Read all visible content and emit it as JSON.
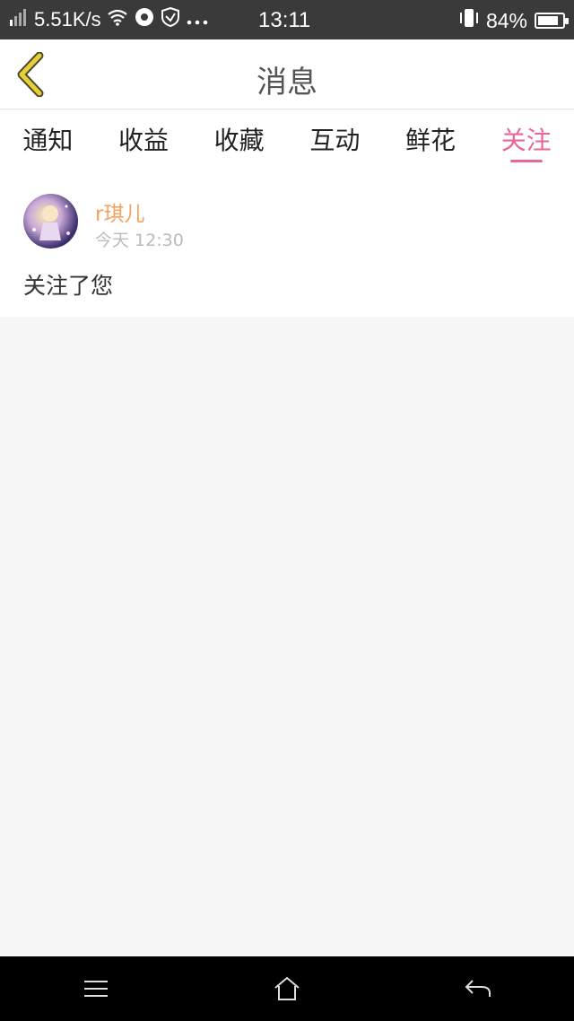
{
  "status_bar": {
    "network_speed": "5.51K/s",
    "time": "13:11",
    "battery_text": "84%",
    "battery_level": 0.84,
    "icons": [
      "signal-icon",
      "wifi-icon",
      "sync-icon",
      "shield-icon",
      "more-dots-icon",
      "phone-vibrate-icon",
      "battery-icon"
    ]
  },
  "nav": {
    "title": "消息",
    "back_icon": "chevron-left-icon"
  },
  "tabs": [
    {
      "label": "通知",
      "active": false
    },
    {
      "label": "收益",
      "active": false
    },
    {
      "label": "收藏",
      "active": false
    },
    {
      "label": "互动",
      "active": false
    },
    {
      "label": "鲜花",
      "active": false
    },
    {
      "label": "关注",
      "active": true
    }
  ],
  "message": {
    "username": "r琪儿",
    "timestamp": "今天 12:30",
    "text": "关注了您"
  },
  "colors": {
    "accent": "#e8679a",
    "username": "#f3a35e",
    "back_icon": "#e6cf3a"
  },
  "system_nav": {
    "icons": [
      "menu-icon",
      "home-icon",
      "back-icon"
    ]
  }
}
